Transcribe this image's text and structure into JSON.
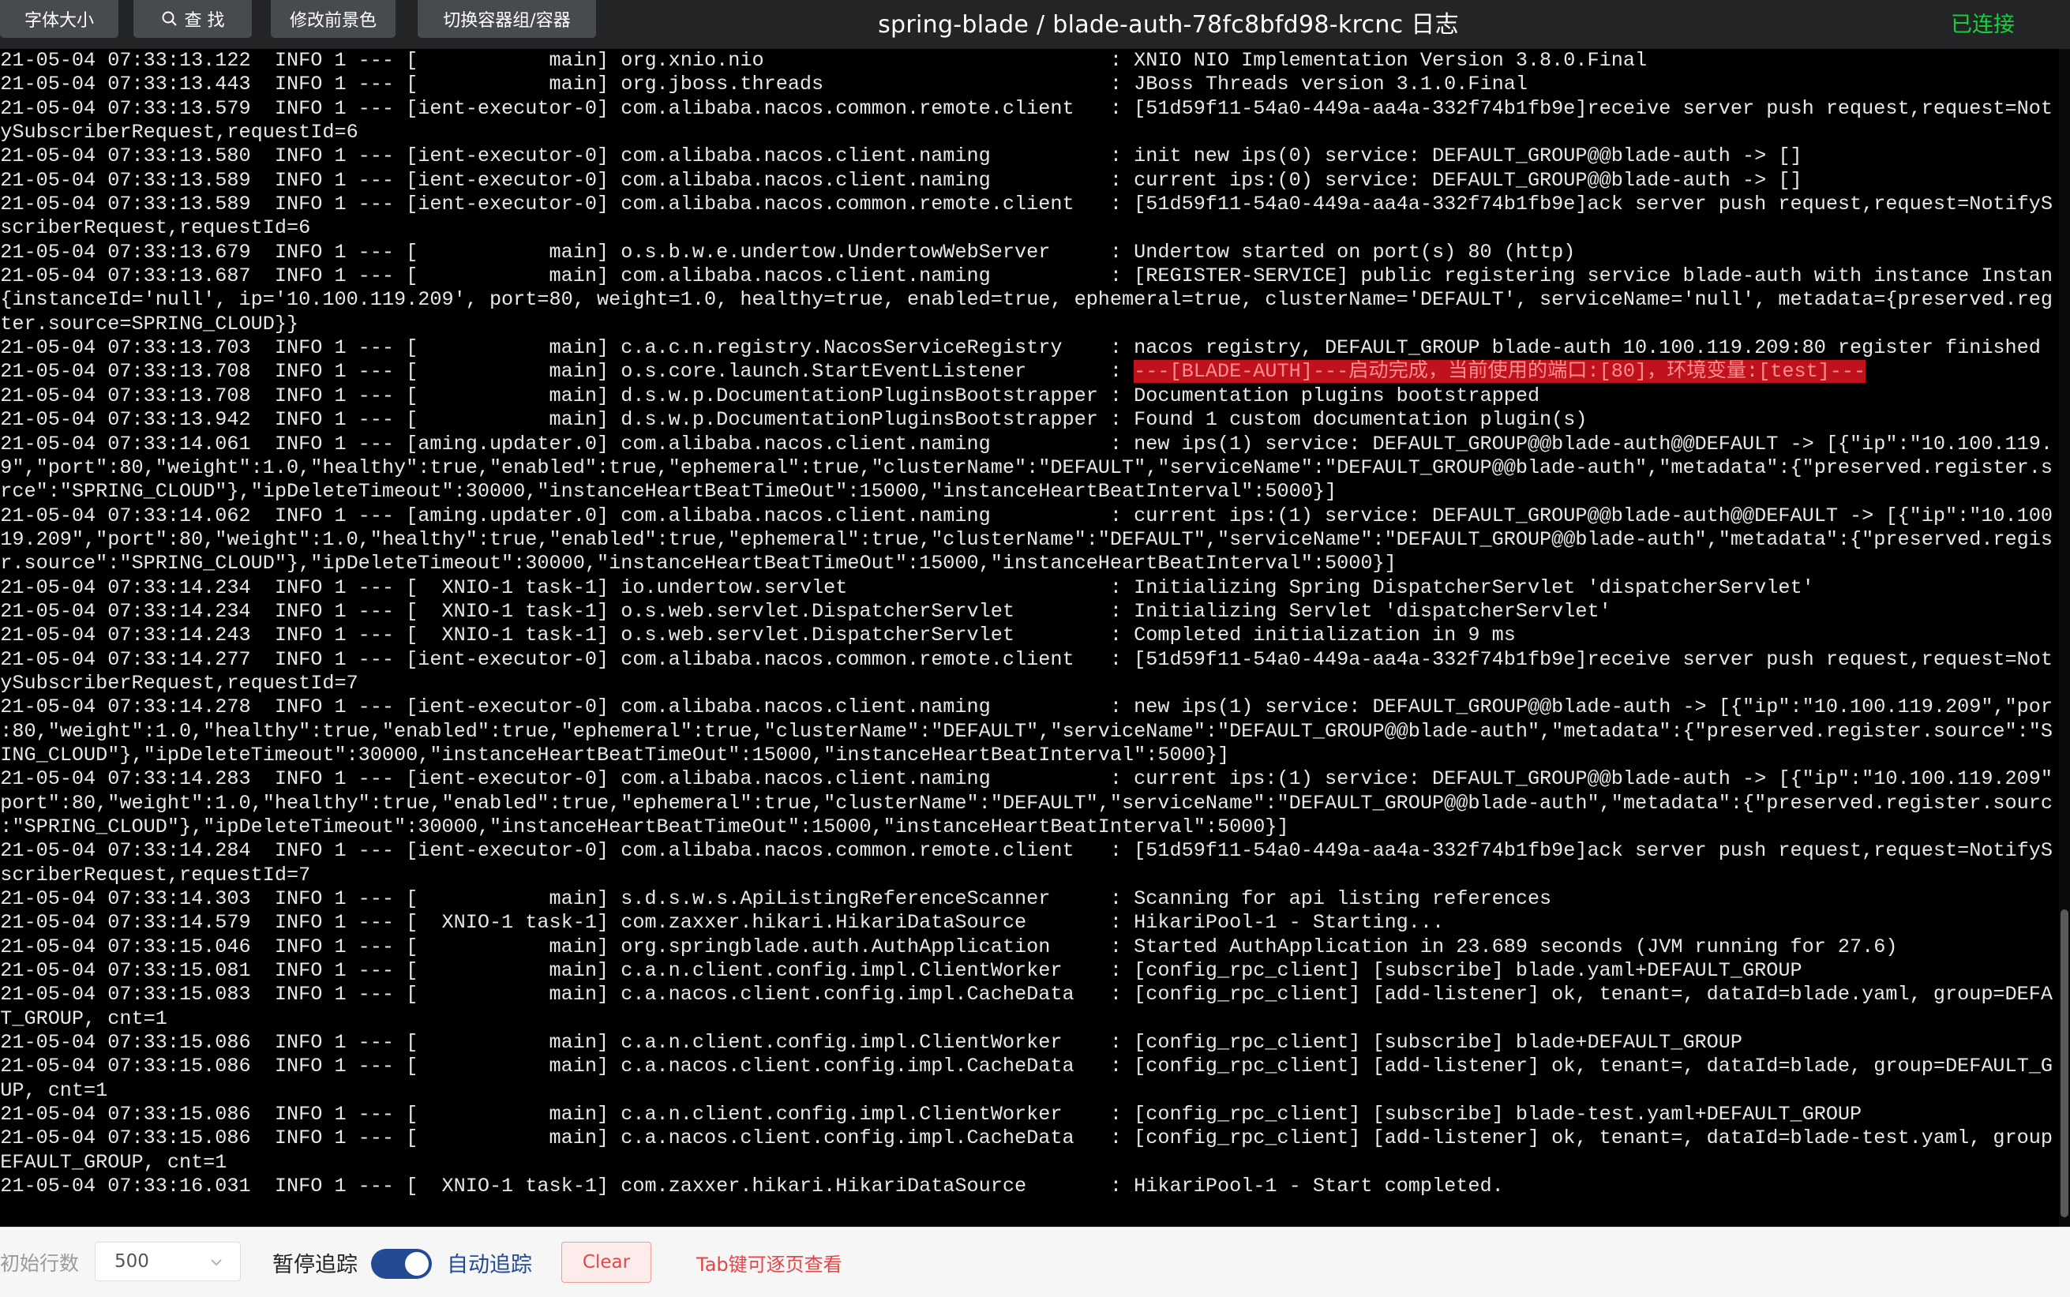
{
  "toolbar": {
    "font_size_label": "字体大小",
    "search_label": "查 找",
    "fg_color_label": "修改前景色",
    "switch_container_label": "切换容器组/容器"
  },
  "header": {
    "title": "spring-blade / blade-auth-78fc8bfd98-krcnc 日志",
    "status": "已连接"
  },
  "colors": {
    "status_connected": "#17d13a",
    "toggle_active": "#234b93",
    "clear_text": "#e64545",
    "highlight_bg": "#c0121c"
  },
  "log": {
    "lines": [
      "2021-05-04 07:33:13.122  INFO 1 --- [           main] org.xnio.nio                             : XNIO NIO Implementation Version 3.8.0.Final",
      "2021-05-04 07:33:13.443  INFO 1 --- [           main] org.jboss.threads                        : JBoss Threads version 3.1.0.Final",
      "2021-05-04 07:33:13.579  INFO 1 --- [ient-executor-0] com.alibaba.nacos.common.remote.client   : [51d59f11-54a0-449a-aa4a-332f74b1fb9e]receive server push request,request=Not",
      "ifySubscriberRequest,requestId=6",
      "2021-05-04 07:33:13.580  INFO 1 --- [ient-executor-0] com.alibaba.nacos.client.naming          : init new ips(0) service: DEFAULT_GROUP@@blade-auth -> []",
      "2021-05-04 07:33:13.589  INFO 1 --- [ient-executor-0] com.alibaba.nacos.client.naming          : current ips:(0) service: DEFAULT_GROUP@@blade-auth -> []",
      "2021-05-04 07:33:13.589  INFO 1 --- [ient-executor-0] com.alibaba.nacos.common.remote.client   : [51d59f11-54a0-449a-aa4a-332f74b1fb9e]ack server push request,request=NotifyS",
      "ubscriberRequest,requestId=6",
      "2021-05-04 07:33:13.679  INFO 1 --- [           main] o.s.b.w.e.undertow.UndertowWebServer     : Undertow started on port(s) 80 (http)",
      "2021-05-04 07:33:13.687  INFO 1 --- [           main] com.alibaba.nacos.client.naming          : [REGISTER-SERVICE] public registering service blade-auth with instance Instan",
      "ce{instanceId='null', ip='10.100.119.209', port=80, weight=1.0, healthy=true, enabled=true, ephemeral=true, clusterName='DEFAULT', serviceName='null', metadata={preserved.reg",
      "ister.source=SPRING_CLOUD}}",
      "2021-05-04 07:33:13.703  INFO 1 --- [           main] c.a.c.n.registry.NacosServiceRegistry    : nacos registry, DEFAULT_GROUP blade-auth 10.100.119.209:80 register finished",
      "2021-05-04 07:33:13.708  INFO 1 --- [           main] o.s.core.launch.StartEventListener       : ---[BLADE-AUTH]---启动完成，当前使用的端口:[80]，环境变量:[test]---",
      "2021-05-04 07:33:13.708  INFO 1 --- [           main] d.s.w.p.DocumentationPluginsBootstrapper : Documentation plugins bootstrapped",
      "2021-05-04 07:33:13.942  INFO 1 --- [           main] d.s.w.p.DocumentationPluginsBootstrapper : Found 1 custom documentation plugin(s)",
      "2021-05-04 07:33:14.061  INFO 1 --- [aming.updater.0] com.alibaba.nacos.client.naming          : new ips(1) service: DEFAULT_GROUP@@blade-auth@@DEFAULT -> [{\"ip\":\"10.100.119.",
      "209\",\"port\":80,\"weight\":1.0,\"healthy\":true,\"enabled\":true,\"ephemeral\":true,\"clusterName\":\"DEFAULT\",\"serviceName\":\"DEFAULT_GROUP@@blade-auth\",\"metadata\":{\"preserved.register.s",
      "ource\":\"SPRING_CLOUD\"},\"ipDeleteTimeout\":30000,\"instanceHeartBeatTimeOut\":15000,\"instanceHeartBeatInterval\":5000}]",
      "2021-05-04 07:33:14.062  INFO 1 --- [aming.updater.0] com.alibaba.nacos.client.naming          : current ips:(1) service: DEFAULT_GROUP@@blade-auth@@DEFAULT -> [{\"ip\":\"10.100",
      ".119.209\",\"port\":80,\"weight\":1.0,\"healthy\":true,\"enabled\":true,\"ephemeral\":true,\"clusterName\":\"DEFAULT\",\"serviceName\":\"DEFAULT_GROUP@@blade-auth\",\"metadata\":{\"preserved.regis",
      "ter.source\":\"SPRING_CLOUD\"},\"ipDeleteTimeout\":30000,\"instanceHeartBeatTimeOut\":15000,\"instanceHeartBeatInterval\":5000}]",
      "2021-05-04 07:33:14.234  INFO 1 --- [  XNIO-1 task-1] io.undertow.servlet                      : Initializing Spring DispatcherServlet 'dispatcherServlet'",
      "2021-05-04 07:33:14.234  INFO 1 --- [  XNIO-1 task-1] o.s.web.servlet.DispatcherServlet        : Initializing Servlet 'dispatcherServlet'",
      "2021-05-04 07:33:14.243  INFO 1 --- [  XNIO-1 task-1] o.s.web.servlet.DispatcherServlet        : Completed initialization in 9 ms",
      "2021-05-04 07:33:14.277  INFO 1 --- [ient-executor-0] com.alibaba.nacos.common.remote.client   : [51d59f11-54a0-449a-aa4a-332f74b1fb9e]receive server push request,request=Not",
      "ifySubscriberRequest,requestId=7",
      "2021-05-04 07:33:14.278  INFO 1 --- [ient-executor-0] com.alibaba.nacos.client.naming          : new ips(1) service: DEFAULT_GROUP@@blade-auth -> [{\"ip\":\"10.100.119.209\",\"por",
      "t\":80,\"weight\":1.0,\"healthy\":true,\"enabled\":true,\"ephemeral\":true,\"clusterName\":\"DEFAULT\",\"serviceName\":\"DEFAULT_GROUP@@blade-auth\",\"metadata\":{\"preserved.register.source\":\"S",
      "PRING_CLOUD\"},\"ipDeleteTimeout\":30000,\"instanceHeartBeatTimeOut\":15000,\"instanceHeartBeatInterval\":5000}]",
      "2021-05-04 07:33:14.283  INFO 1 --- [ient-executor-0] com.alibaba.nacos.client.naming          : current ips:(1) service: DEFAULT_GROUP@@blade-auth -> [{\"ip\":\"10.100.119.209\"",
      ",\"port\":80,\"weight\":1.0,\"healthy\":true,\"enabled\":true,\"ephemeral\":true,\"clusterName\":\"DEFAULT\",\"serviceName\":\"DEFAULT_GROUP@@blade-auth\",\"metadata\":{\"preserved.register.sourc",
      "e\":\"SPRING_CLOUD\"},\"ipDeleteTimeout\":30000,\"instanceHeartBeatTimeOut\":15000,\"instanceHeartBeatInterval\":5000}]",
      "2021-05-04 07:33:14.284  INFO 1 --- [ient-executor-0] com.alibaba.nacos.common.remote.client   : [51d59f11-54a0-449a-aa4a-332f74b1fb9e]ack server push request,request=NotifyS",
      "ubscriberRequest,requestId=7",
      "2021-05-04 07:33:14.303  INFO 1 --- [           main] s.d.s.w.s.ApiListingReferenceScanner     : Scanning for api listing references",
      "2021-05-04 07:33:14.579  INFO 1 --- [  XNIO-1 task-1] com.zaxxer.hikari.HikariDataSource       : HikariPool-1 - Starting...",
      "2021-05-04 07:33:15.046  INFO 1 --- [           main] org.springblade.auth.AuthApplication     : Started AuthApplication in 23.689 seconds (JVM running for 27.6)",
      "2021-05-04 07:33:15.081  INFO 1 --- [           main] c.a.n.client.config.impl.ClientWorker    : [config_rpc_client] [subscribe] blade.yaml+DEFAULT_GROUP",
      "2021-05-04 07:33:15.083  INFO 1 --- [           main] c.a.nacos.client.config.impl.CacheData   : [config_rpc_client] [add-listener] ok, tenant=, dataId=blade.yaml, group=DEFA",
      "ULT_GROUP, cnt=1",
      "2021-05-04 07:33:15.086  INFO 1 --- [           main] c.a.n.client.config.impl.ClientWorker    : [config_rpc_client] [subscribe] blade+DEFAULT_GROUP",
      "2021-05-04 07:33:15.086  INFO 1 --- [           main] c.a.nacos.client.config.impl.CacheData   : [config_rpc_client] [add-listener] ok, tenant=, dataId=blade, group=DEFAULT_G",
      "ROUP, cnt=1",
      "2021-05-04 07:33:15.086  INFO 1 --- [           main] c.a.n.client.config.impl.ClientWorker    : [config_rpc_client] [subscribe] blade-test.yaml+DEFAULT_GROUP",
      "2021-05-04 07:33:15.086  INFO 1 --- [           main] c.a.nacos.client.config.impl.CacheData   : [config_rpc_client] [add-listener] ok, tenant=, dataId=blade-test.yaml, group",
      "=DEFAULT_GROUP, cnt=1",
      "2021-05-04 07:33:16.031  INFO 1 --- [  XNIO-1 task-1] com.zaxxer.hikari.HikariDataSource       : HikariPool-1 - Start completed."
    ],
    "highlight": {
      "prefix": "2021-05-04 07:33:13.708  INFO 1 --- [           main] o.s.core.launch.StartEventListener       : ",
      "text": "---[BLADE-AUTH]---启动完成，当前使用的端口:[80]，环境变量:[test]---"
    }
  },
  "footer": {
    "initial_lines_label": "初始行数",
    "initial_lines_value": "500",
    "pause_label": "暂停追踪",
    "toggle_on": true,
    "auto_label": "自动追踪",
    "clear_label": "Clear",
    "hint": "Tab键可逐页查看"
  }
}
